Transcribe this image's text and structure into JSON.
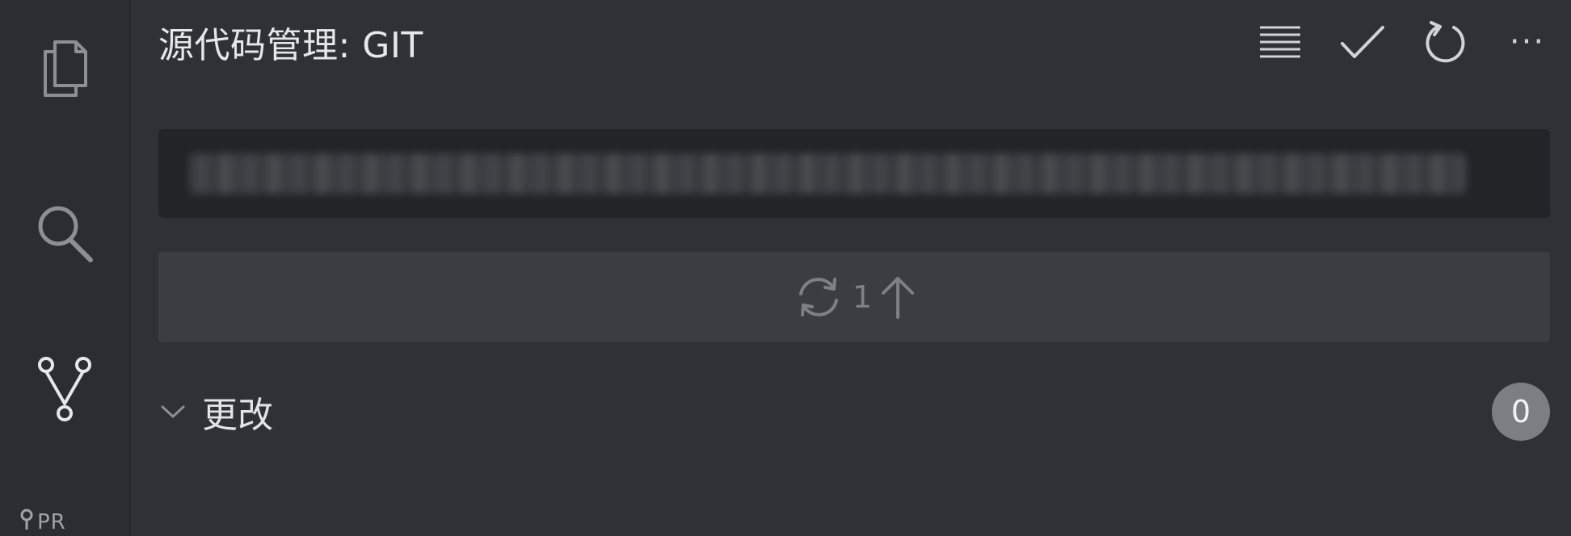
{
  "activity_bar": {
    "items": [
      {
        "name": "explorer",
        "icon": "files-icon"
      },
      {
        "name": "search",
        "icon": "search-icon"
      },
      {
        "name": "source-control",
        "icon": "source-control-icon"
      }
    ],
    "pr_label": "PR"
  },
  "panel": {
    "title": "源代码管理: GIT",
    "actions": [
      {
        "name": "view-as-list",
        "icon": "list-icon"
      },
      {
        "name": "commit",
        "icon": "check-icon"
      },
      {
        "name": "refresh",
        "icon": "refresh-icon"
      },
      {
        "name": "more-actions",
        "icon": "ellipsis-icon",
        "label": "···"
      }
    ]
  },
  "commit": {
    "message_value": "",
    "message_obscured": true
  },
  "sync": {
    "count": "1"
  },
  "changes": {
    "label": "更改",
    "count": "0"
  },
  "colors": {
    "background": "#2f3136",
    "activity_bar": "#2b2d32",
    "input_bg": "#232427",
    "button_bg": "#3a3d42",
    "badge_bg": "#7b7e83",
    "text": "#e6e7e9",
    "muted_text": "#7d8086"
  }
}
